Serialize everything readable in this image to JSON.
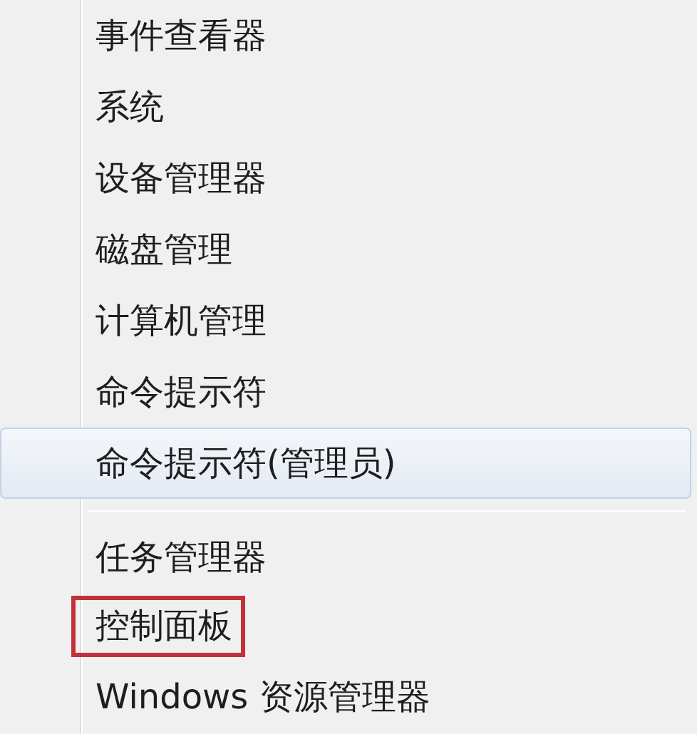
{
  "menu": {
    "items": [
      {
        "kind": "item",
        "label": "事件查看器",
        "selected": false,
        "outlined": false
      },
      {
        "kind": "item",
        "label": "系统",
        "selected": false,
        "outlined": false
      },
      {
        "kind": "item",
        "label": "设备管理器",
        "selected": false,
        "outlined": false
      },
      {
        "kind": "item",
        "label": "磁盘管理",
        "selected": false,
        "outlined": false
      },
      {
        "kind": "item",
        "label": "计算机管理",
        "selected": false,
        "outlined": false
      },
      {
        "kind": "item",
        "label": "命令提示符",
        "selected": false,
        "outlined": false
      },
      {
        "kind": "item",
        "label": "命令提示符(管理员)",
        "selected": true,
        "outlined": false
      },
      {
        "kind": "separator"
      },
      {
        "kind": "item",
        "label": "任务管理器",
        "selected": false,
        "outlined": false
      },
      {
        "kind": "item",
        "label": "控制面板",
        "selected": false,
        "outlined": true
      },
      {
        "kind": "item",
        "label": "Windows 资源管理器",
        "selected": false,
        "outlined": false
      }
    ]
  }
}
